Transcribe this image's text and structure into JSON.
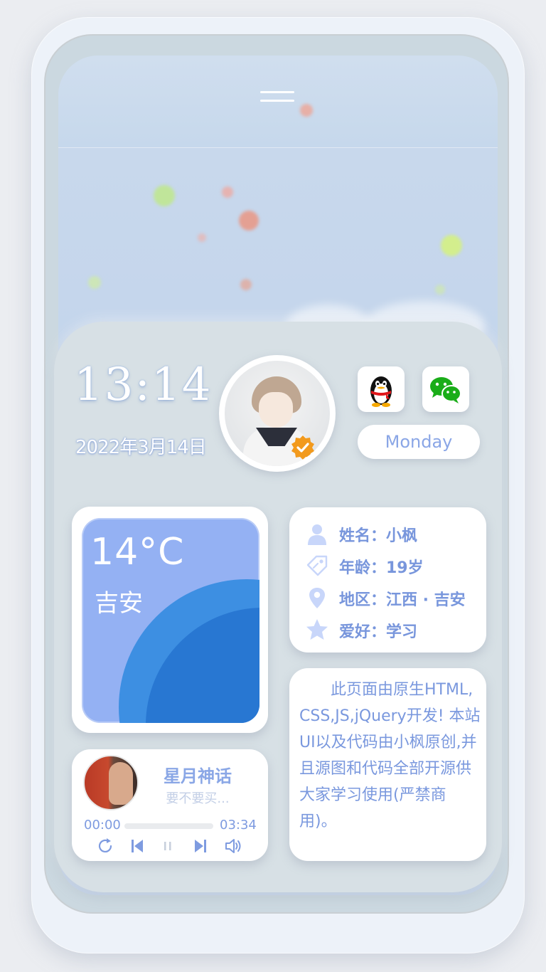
{
  "header": {
    "menu_icon": "menu-icon"
  },
  "clock": {
    "time": "13:14",
    "date": "2022年3月14日",
    "weekday": "Monday"
  },
  "social": {
    "qq_icon": "qq-penguin-icon",
    "wechat_icon": "wechat-icon"
  },
  "avatar": {
    "badge_icon": "verified-badge-icon"
  },
  "weather": {
    "temperature": "14°C",
    "city": "吉安"
  },
  "music": {
    "title": "星月神话",
    "artist": "要不要买...",
    "current_time": "00:00",
    "total_time": "03:34",
    "progress": 0,
    "controls": [
      "repeat-icon",
      "previous-icon",
      "pause-icon",
      "next-icon",
      "volume-icon"
    ]
  },
  "profile": {
    "rows": [
      {
        "icon": "user-icon",
        "text": "姓名：小枫"
      },
      {
        "icon": "tag-icon",
        "text": "年龄：19岁"
      },
      {
        "icon": "location-icon",
        "text": "地区：江西 · 吉安"
      },
      {
        "icon": "star-icon",
        "text": "爱好：学习"
      }
    ]
  },
  "description": "此页面由原生HTML,CSS,JS,jQuery开发! 本站UI以及代码由小枫原创,并且源图和代码全部开源供大家学习使用(严禁商用)。",
  "colors": {
    "accent": "#7a98de",
    "weather_bg": "#94b1f3",
    "weather_arc": "#2877d2",
    "panel": "#d7e0e5"
  }
}
